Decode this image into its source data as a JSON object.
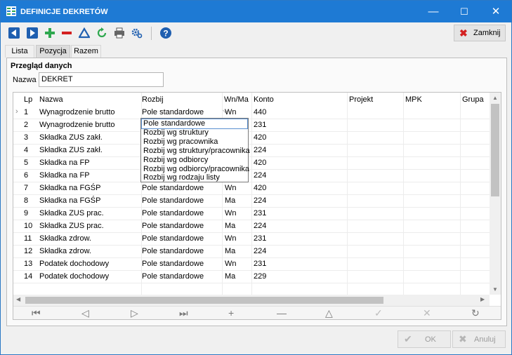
{
  "window": {
    "title": "DEFINICJE DEKRETÓW",
    "minimize": "—",
    "maximize": "☐",
    "close": "✕"
  },
  "toolbar": {
    "icons": [
      "prev-icon",
      "next-icon",
      "add-icon",
      "remove-icon",
      "edit-icon",
      "refresh-icon",
      "print-icon",
      "settings-icon",
      "help-icon"
    ],
    "close_label": "Zamknij"
  },
  "tabs": [
    {
      "label": "Lista"
    },
    {
      "label": "Pozycja"
    },
    {
      "label": "Razem"
    }
  ],
  "section": {
    "title": "Przegląd danych",
    "name_label": "Nazwa",
    "name_value": "DEKRET"
  },
  "grid": {
    "columns": [
      "Lp",
      "Nazwa",
      "Rozbij",
      "Wn/Ma",
      "Konto",
      "Projekt",
      "MPK",
      "Grupa"
    ],
    "rows": [
      {
        "lp": "1",
        "nazwa": "Wynagrodzenie brutto",
        "rozbij": "Pole standardowe",
        "wnma": "Wn",
        "konto": "440"
      },
      {
        "lp": "2",
        "nazwa": "Wynagrodzenie brutto",
        "rozbij": "",
        "wnma": "",
        "konto": "231"
      },
      {
        "lp": "3",
        "nazwa": "Składka ZUS zakł.",
        "rozbij": "",
        "wnma": "",
        "konto": "420"
      },
      {
        "lp": "4",
        "nazwa": "Składka ZUS zakł.",
        "rozbij": "",
        "wnma": "",
        "konto": "224"
      },
      {
        "lp": "5",
        "nazwa": "Składka na FP",
        "rozbij": "",
        "wnma": "",
        "konto": "420"
      },
      {
        "lp": "6",
        "nazwa": "Składka na FP",
        "rozbij": "",
        "wnma": "",
        "konto": "224"
      },
      {
        "lp": "7",
        "nazwa": "Składka na FGŚP",
        "rozbij": "Pole standardowe",
        "wnma": "Wn",
        "konto": "420"
      },
      {
        "lp": "8",
        "nazwa": "Składka na FGŚP",
        "rozbij": "Pole standardowe",
        "wnma": "Ma",
        "konto": "224"
      },
      {
        "lp": "9",
        "nazwa": "Składka ZUS prac.",
        "rozbij": "Pole standardowe",
        "wnma": "Wn",
        "konto": "231"
      },
      {
        "lp": "10",
        "nazwa": "Składka ZUS prac.",
        "rozbij": "Pole standardowe",
        "wnma": "Ma",
        "konto": "224"
      },
      {
        "lp": "11",
        "nazwa": "Składka zdrow.",
        "rozbij": "Pole standardowe",
        "wnma": "Wn",
        "konto": "231"
      },
      {
        "lp": "12",
        "nazwa": "Składka zdrow.",
        "rozbij": "Pole standardowe",
        "wnma": "Ma",
        "konto": "224"
      },
      {
        "lp": "13",
        "nazwa": "Podatek dochodowy",
        "rozbij": "Pole standardowe",
        "wnma": "Wn",
        "konto": "231"
      },
      {
        "lp": "14",
        "nazwa": "Podatek dochodowy",
        "rozbij": "Pole standardowe",
        "wnma": "Ma",
        "konto": "229"
      }
    ]
  },
  "dropdown": {
    "selected": "Pole standardowe",
    "options": [
      "Pole standardowe",
      "Rozbij wg struktury",
      "Rozbij wg pracownika",
      "Rozbij wg struktury/pracownika",
      "Rozbij wg odbiorcy",
      "Rozbij wg odbiorcy/pracownika",
      "Rozbij wg rodzaju listy"
    ]
  },
  "navigator": {
    "first": "⏮",
    "prev": "◁",
    "next": "▷",
    "last": "⏭",
    "add": "+",
    "remove": "—",
    "edit": "△",
    "confirm": "✓",
    "cancel": "✕",
    "refresh": "↻"
  },
  "footer": {
    "ok_label": "OK",
    "cancel_label": "Anuluj"
  },
  "colors": {
    "titlebar": "#1e7ad4",
    "accent_blue": "#1f5fb0",
    "add_green": "#2fa84f",
    "remove_red": "#d32020"
  }
}
